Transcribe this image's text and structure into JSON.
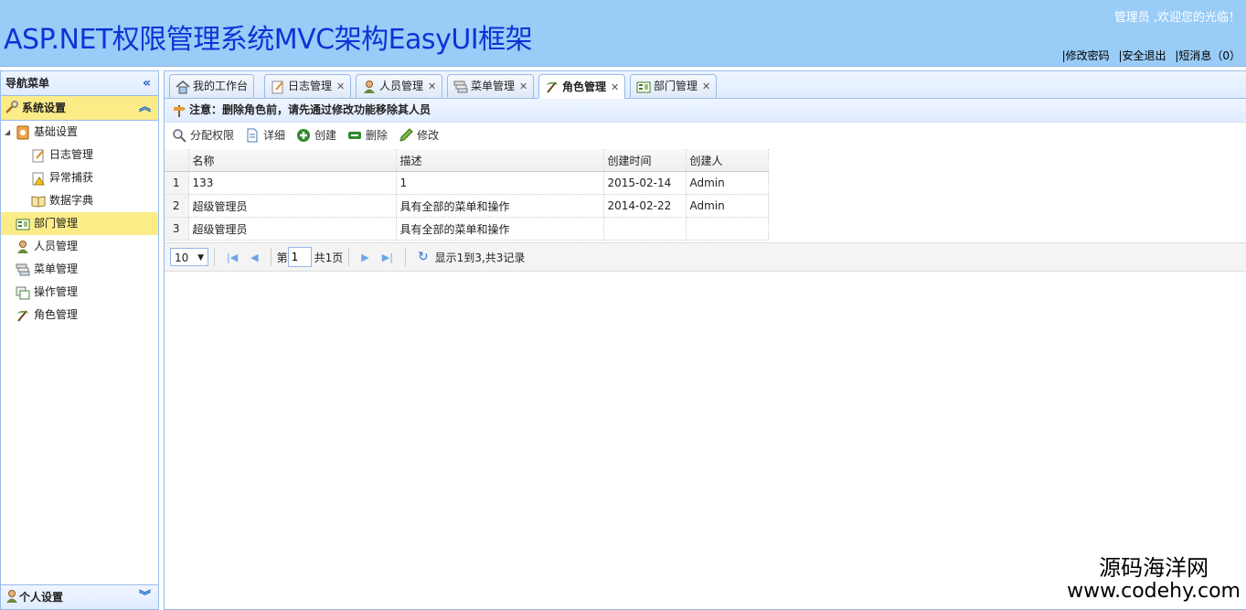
{
  "header": {
    "title": "ASP.NET权限管理系统MVC架构EasyUI框架",
    "welcome": "管理员 ,欢迎您的光临！",
    "links": [
      "|修改密码",
      "|安全退出",
      "|短消息（0）"
    ]
  },
  "sidebar": {
    "title": "导航菜单",
    "section_title": "系统设置",
    "items": [
      {
        "label": "基础设置",
        "icon": "settings-book-icon"
      },
      {
        "label": "日志管理",
        "icon": "log-edit-icon"
      },
      {
        "label": "异常捕获",
        "icon": "warning-icon"
      },
      {
        "label": "数据字典",
        "icon": "book-icon"
      },
      {
        "label": "部门管理",
        "icon": "department-icon"
      },
      {
        "label": "人员管理",
        "icon": "user-icon"
      },
      {
        "label": "菜单管理",
        "icon": "menu-icon"
      },
      {
        "label": "操作管理",
        "icon": "operation-icon"
      },
      {
        "label": "角色管理",
        "icon": "role-icon"
      }
    ],
    "bottom_section": "个人设置"
  },
  "tabs": [
    {
      "label": "我的工作台",
      "icon": "home-icon"
    },
    {
      "label": "日志管理",
      "icon": "log-edit-icon"
    },
    {
      "label": "人员管理",
      "icon": "user-icon"
    },
    {
      "label": "菜单管理",
      "icon": "menu-icon"
    },
    {
      "label": "角色管理",
      "icon": "role-icon"
    },
    {
      "label": "部门管理",
      "icon": "department-icon"
    }
  ],
  "notice": "注意：删除角色前，请先通过修改功能移除其人员",
  "toolbar": {
    "assign": "分配权限",
    "detail": "详细",
    "create": "创建",
    "delete": "删除",
    "edit": "修改"
  },
  "grid": {
    "columns": [
      "名称",
      "描述",
      "创建时间",
      "创建人"
    ],
    "rows": [
      {
        "n": "1",
        "name": "133",
        "desc": "1",
        "time": "2015-02-14",
        "creator": "Admin"
      },
      {
        "n": "2",
        "name": "超级管理员",
        "desc": "具有全部的菜单和操作",
        "time": "2014-02-22",
        "creator": "Admin"
      },
      {
        "n": "3",
        "name": "超级管理员",
        "desc": "具有全部的菜单和操作",
        "time": "",
        "creator": ""
      }
    ]
  },
  "pager": {
    "page_size": "10",
    "page_prefix": "第",
    "page_value": "1",
    "page_total": "共1页",
    "info": "显示1到3,共3记录"
  },
  "watermark": {
    "cn": "源码海洋网",
    "en": "www.codehy.com"
  },
  "colors": {
    "header_bg": "#99ccf7",
    "title": "#0b34d6",
    "selected": "#fbec88",
    "border": "#99bbe8"
  }
}
